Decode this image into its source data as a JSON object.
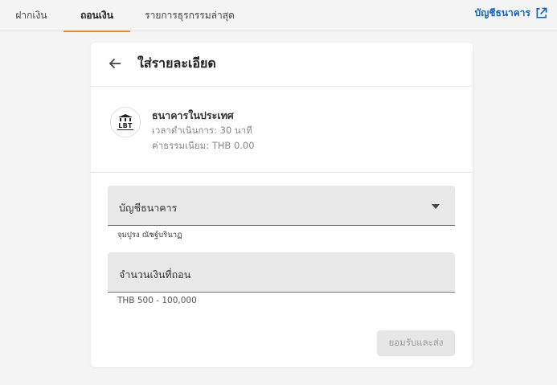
{
  "tabs": [
    {
      "label": "ฝากเงิน",
      "active": false
    },
    {
      "label": "ถอนเงิน",
      "active": true
    },
    {
      "label": "รายการธุรกรรมล่าสุด",
      "active": false
    }
  ],
  "bank_accounts_link": {
    "label": "บัญชีธนาคาร",
    "icon": "external-link-icon"
  },
  "colors": {
    "accent": "#e8892e",
    "link": "#1565c0"
  },
  "card": {
    "title": "ใส่รายละเอียด",
    "back_icon": "arrow-left-icon",
    "method": {
      "logo_text": "LBT",
      "name": "ธนาคารในประเทศ",
      "processing_time": "เวลาดำเนินการ: 30 นาที",
      "fee": "ค่าธรรมเนียม: THB 0.00"
    },
    "bank_account_field": {
      "label": "บัญชีธนาคาร",
      "helper": "จุมปูรง ณัชฐ์บรินาฏ"
    },
    "amount_field": {
      "label": "จำนวนเงินที่ถอน",
      "helper": "THB 500 - 100,000"
    },
    "submit_label": "ยอมรับและส่ง"
  }
}
